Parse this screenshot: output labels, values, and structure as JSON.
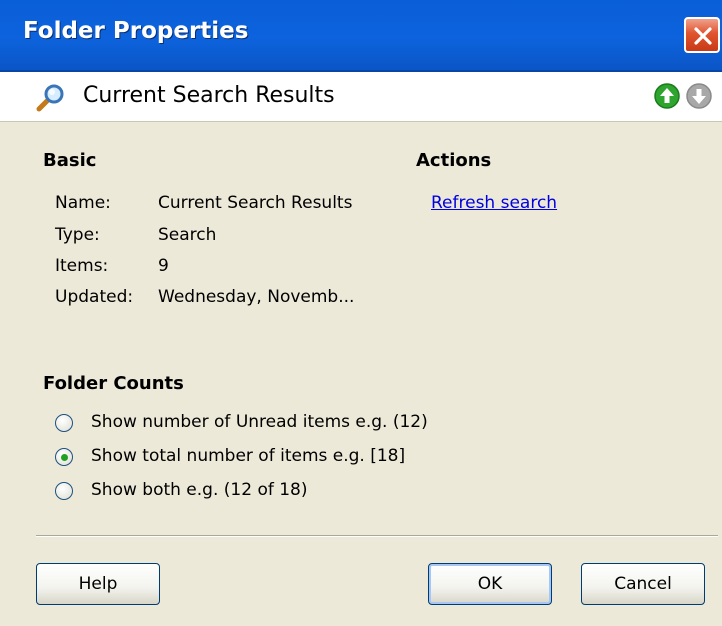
{
  "window": {
    "title": "Folder Properties"
  },
  "header": {
    "title": "Current Search Results",
    "icon": "magnifier-icon"
  },
  "basic": {
    "heading": "Basic",
    "rows": [
      {
        "label": "Name:",
        "value": "Current Search Results"
      },
      {
        "label": "Type:",
        "value": "Search"
      },
      {
        "label": "Items:",
        "value": "9"
      },
      {
        "label": "Updated:",
        "value": "Wednesday, Novemb..."
      }
    ]
  },
  "actions": {
    "heading": "Actions",
    "refresh_link": "Refresh search"
  },
  "folder_counts": {
    "heading": "Folder Counts",
    "options": [
      {
        "label": "Show number of Unread items  e.g. (12)",
        "selected": false
      },
      {
        "label": "Show total number of items  e.g. [18]",
        "selected": true
      },
      {
        "label": "Show both  e.g. (12 of 18)",
        "selected": false
      }
    ]
  },
  "buttons": {
    "help": "Help",
    "ok": "OK",
    "cancel": "Cancel"
  },
  "colors": {
    "titlebar": "#0a5fd8",
    "link": "#0000e0",
    "close": "#e0542e",
    "nav_up": "#2ea52e",
    "nav_down": "#9a9a9a"
  }
}
